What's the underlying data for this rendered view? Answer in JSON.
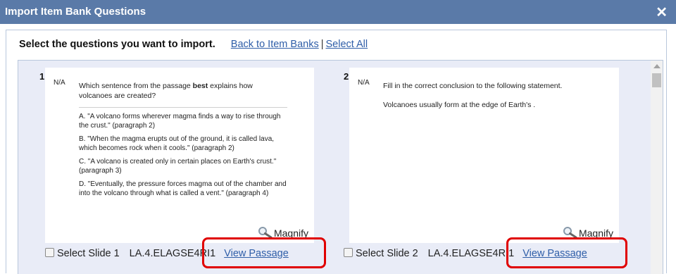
{
  "dialog": {
    "title": "Import Item Bank Questions",
    "close_glyph": "✕"
  },
  "header": {
    "prompt": "Select the questions you want to import.",
    "back_link": "Back to Item Banks",
    "separator": "|",
    "select_all": "Select All"
  },
  "cards": [
    {
      "number": "1",
      "na": "N/A",
      "question_pre": "Which sentence from the passage ",
      "question_bold": "best",
      "question_post": " explains how volcanoes are created?",
      "answers": [
        "A. \"A volcano forms wherever magma finds a way to rise through the crust.\" (paragraph 2)",
        "B. \"When the magma erupts out of the ground, it is called lava, which becomes rock when it cools.\" (paragraph 2)",
        "C. \"A volcano is created only in certain places on Earth's crust.\" (paragraph 3)",
        "D. \"Eventually, the pressure forces magma out of the chamber and into the volcano through what is called a vent.\" (paragraph 4)"
      ],
      "magnify": "Magnify",
      "select_label": "Select Slide 1",
      "standard": "LA.4.ELAGSE4RI1",
      "view_passage": "View Passage"
    },
    {
      "number": "2",
      "na": "N/A",
      "line1": "Fill in the correct conclusion to the following statement.",
      "line2": "Volcanoes usually form at the edge of Earth's .",
      "magnify": "Magnify",
      "select_label": "Select Slide 2",
      "standard": "LA.4.ELAGSE4RI1",
      "view_passage": "View Passage"
    }
  ],
  "colors": {
    "titlebar": "#5a7aa8",
    "link": "#2f5ea8",
    "panel": "#e9ecf7",
    "highlight": "#e00000"
  },
  "icons": [
    "close-icon",
    "magnify-icon",
    "checkbox-icon",
    "scroll-up-arrow"
  ]
}
